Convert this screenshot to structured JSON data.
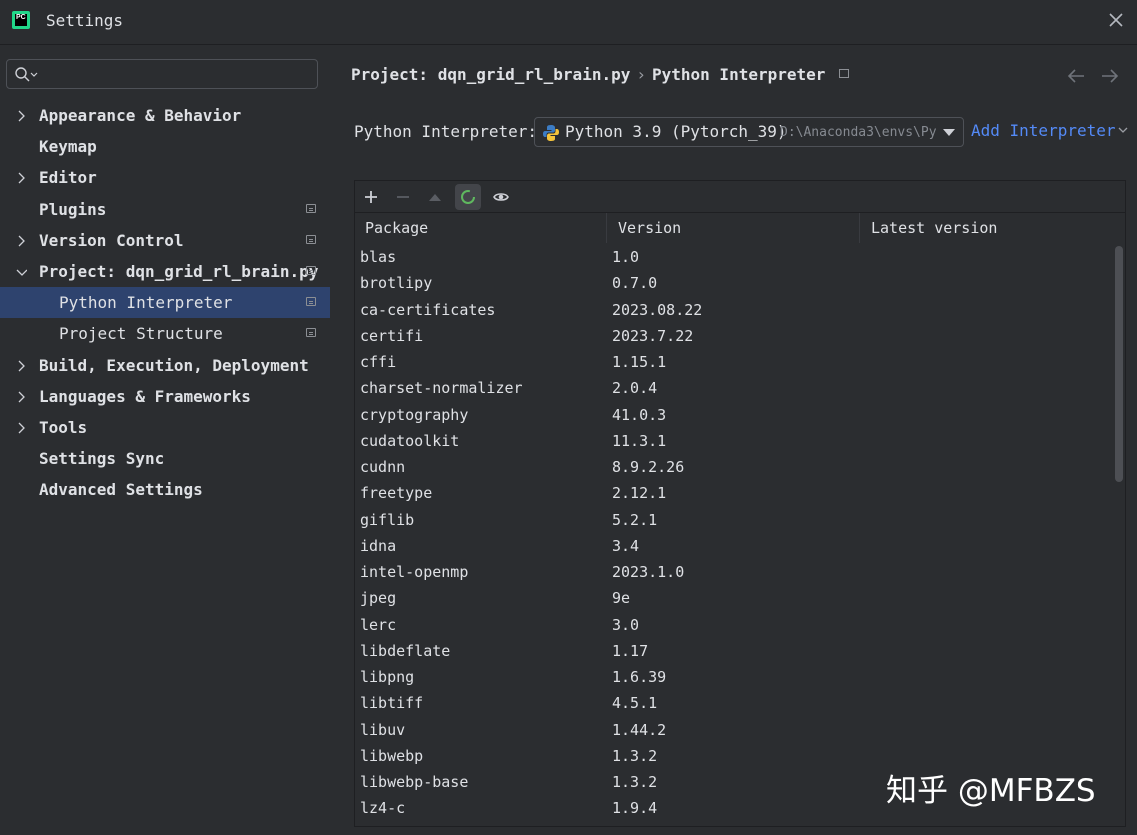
{
  "window": {
    "title": "Settings"
  },
  "search": {
    "placeholder": "",
    "value": ""
  },
  "sidebar": {
    "items": [
      {
        "label": "Appearance & Behavior"
      },
      {
        "label": "Keymap"
      },
      {
        "label": "Editor"
      },
      {
        "label": "Plugins"
      },
      {
        "label": "Version Control"
      },
      {
        "label": "Project: dqn_grid_rl_brain.py"
      },
      {
        "label": "Python Interpreter"
      },
      {
        "label": "Project Structure"
      },
      {
        "label": "Build, Execution, Deployment"
      },
      {
        "label": "Languages & Frameworks"
      },
      {
        "label": "Tools"
      },
      {
        "label": "Settings Sync"
      },
      {
        "label": "Advanced Settings"
      }
    ]
  },
  "breadcrumb": {
    "project": "Project: dqn_grid_rl_brain.py",
    "separator": "›",
    "page": "Python Interpreter"
  },
  "interpreter": {
    "label": "Python Interpreter:",
    "selected": "Python 3.9 (Pytorch_39)",
    "path": "D:\\Anaconda3\\envs\\Py",
    "add_label": "Add Interpreter"
  },
  "table": {
    "columns": [
      "Package",
      "Version",
      "Latest version"
    ],
    "rows": [
      [
        "blas",
        "1.0",
        ""
      ],
      [
        "brotlipy",
        "0.7.0",
        ""
      ],
      [
        "ca-certificates",
        "2023.08.22",
        ""
      ],
      [
        "certifi",
        "2023.7.22",
        ""
      ],
      [
        "cffi",
        "1.15.1",
        ""
      ],
      [
        "charset-normalizer",
        "2.0.4",
        ""
      ],
      [
        "cryptography",
        "41.0.3",
        ""
      ],
      [
        "cudatoolkit",
        "11.3.1",
        ""
      ],
      [
        "cudnn",
        "8.9.2.26",
        ""
      ],
      [
        "freetype",
        "2.12.1",
        ""
      ],
      [
        "giflib",
        "5.2.1",
        ""
      ],
      [
        "idna",
        "3.4",
        ""
      ],
      [
        "intel-openmp",
        "2023.1.0",
        ""
      ],
      [
        "jpeg",
        "9e",
        ""
      ],
      [
        "lerc",
        "3.0",
        ""
      ],
      [
        "libdeflate",
        "1.17",
        ""
      ],
      [
        "libpng",
        "1.6.39",
        ""
      ],
      [
        "libtiff",
        "4.5.1",
        ""
      ],
      [
        "libuv",
        "1.44.2",
        ""
      ],
      [
        "libwebp",
        "1.3.2",
        ""
      ],
      [
        "libwebp-base",
        "1.3.2",
        ""
      ],
      [
        "lz4-c",
        "1.9.4",
        ""
      ]
    ]
  },
  "watermark": {
    "text": "知乎 @MFBZS"
  },
  "colors": {
    "background": "#2b2d30",
    "selection": "#2e436e",
    "link": "#548af7",
    "text": "#dfe1e5"
  }
}
